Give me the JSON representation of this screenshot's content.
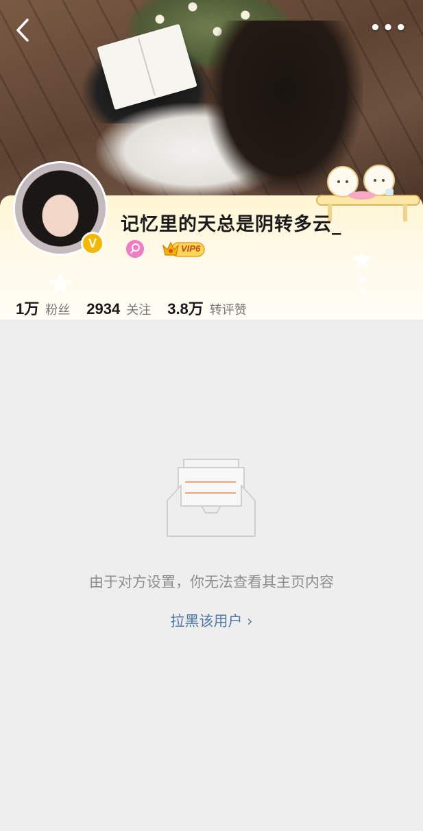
{
  "nav": {
    "back_icon": "chevron-left-icon",
    "more_icon": "more-dots-icon",
    "more_label": "•••"
  },
  "profile": {
    "username": "记忆里的天总是阴转多云_",
    "verified_badge": "V",
    "gender_icon": "female-icon",
    "vip_label": "VIP6",
    "accent_color": "#f5b800"
  },
  "stats": [
    {
      "value": "1万",
      "label": "粉丝"
    },
    {
      "value": "2934",
      "label": "关注"
    },
    {
      "value": "3.8万",
      "label": "转评赞"
    }
  ],
  "empty_state": {
    "icon": "empty-inbox-icon",
    "message": "由于对方设置，你无法查看其主页内容",
    "action_label": "拉黑该用户 ›",
    "action_color": "#4f78a8"
  }
}
